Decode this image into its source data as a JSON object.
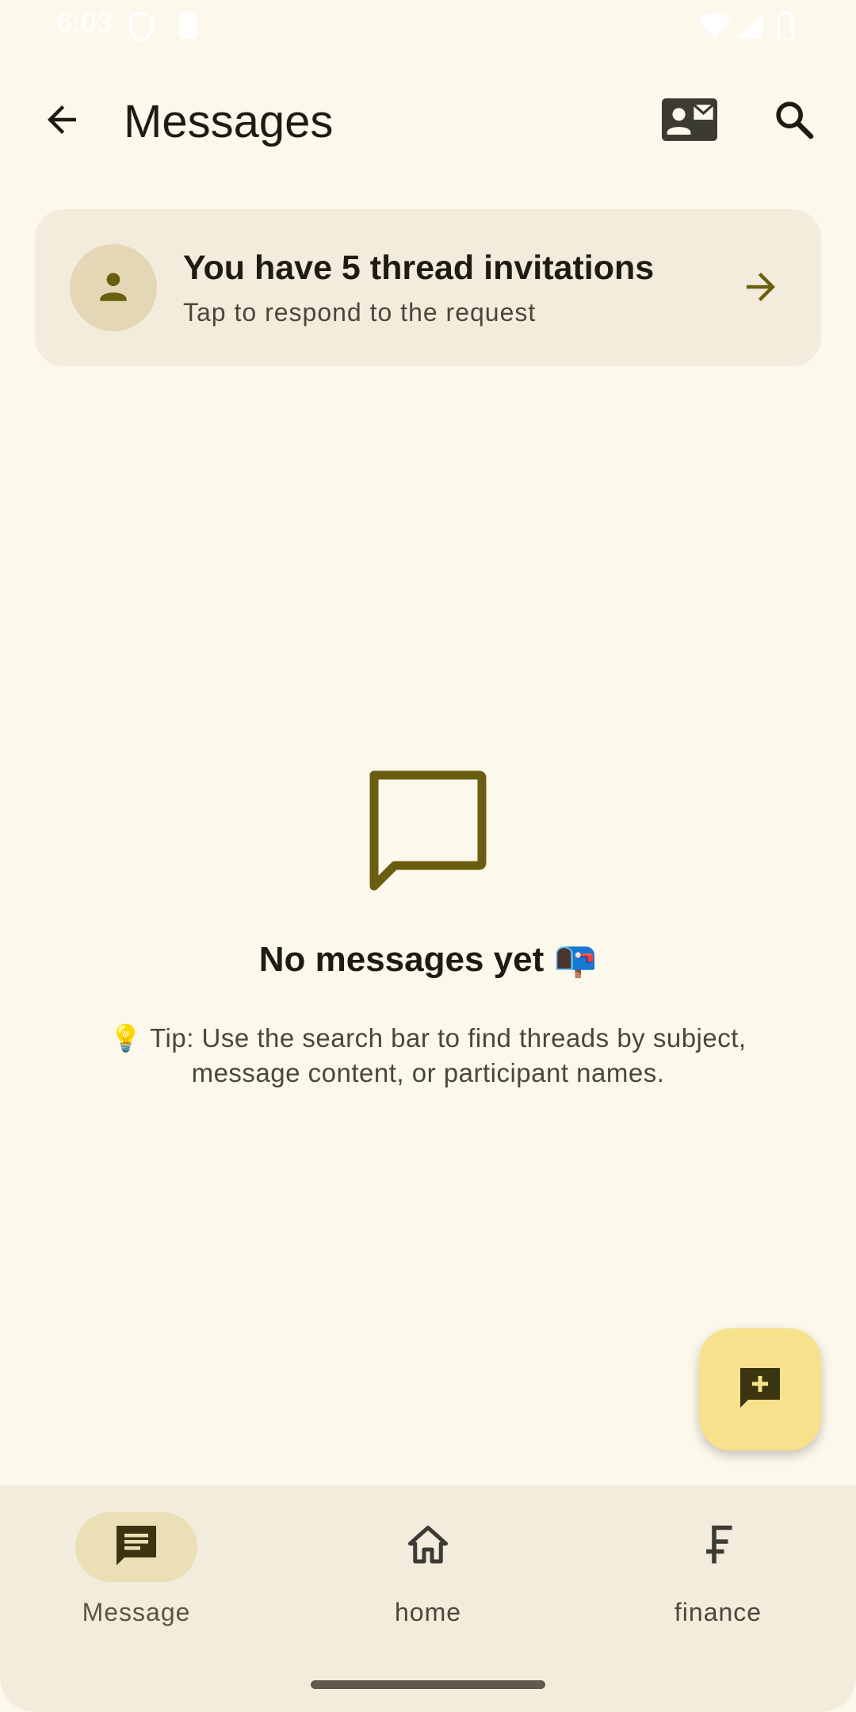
{
  "status_bar": {
    "time": "6:03",
    "icons": [
      "shield-icon",
      "sim-card-icon",
      "wifi-icon",
      "signal-icon",
      "battery-icon"
    ]
  },
  "app_bar": {
    "title": "Messages",
    "back_icon": "arrow-back-icon",
    "contact_icon": "contact-mail-icon",
    "search_icon": "search-icon"
  },
  "invite_card": {
    "title": "You have 5 thread invitations",
    "subtitle": "Tap to respond to the request",
    "avatar_icon": "person-icon",
    "arrow_icon": "arrow-forward-icon"
  },
  "empty_state": {
    "icon": "chat-bubble-outline-icon",
    "title": "No messages yet 📭",
    "tip": "💡 Tip: Use the search bar to find threads by subject, message content, or participant names."
  },
  "fab": {
    "icon": "add-comment-icon"
  },
  "bottom_nav": {
    "items": [
      {
        "label": "Message",
        "icon": "message-icon",
        "active": true
      },
      {
        "label": "home",
        "icon": "home-icon",
        "active": false
      },
      {
        "label": "finance",
        "icon": "currency-icon",
        "active": false
      }
    ]
  },
  "colors": {
    "background": "#fdf8ec",
    "surface": "#f3ecdc",
    "accent": "#6b5d0f",
    "fab": "#f6e28c",
    "active_pill": "#ebdfb6",
    "text_primary": "#1e1b13",
    "text_secondary": "#4a4739"
  }
}
